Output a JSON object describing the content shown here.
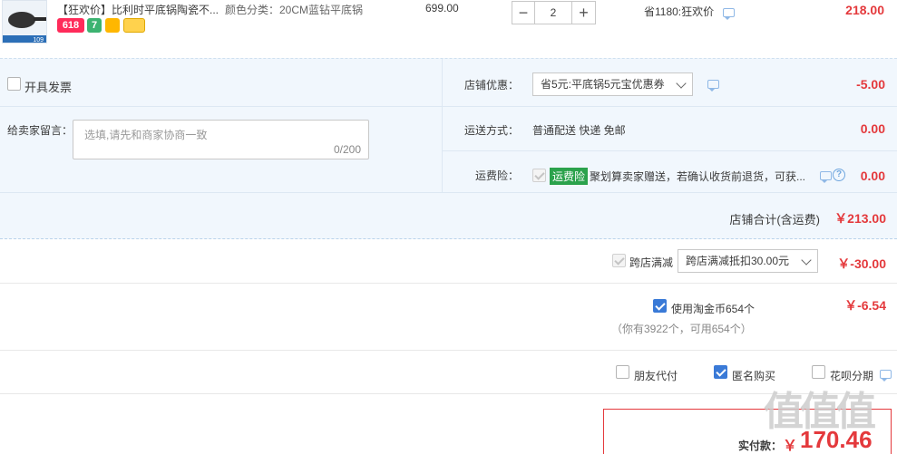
{
  "item": {
    "title": "【狂欢价】比利时平底锅陶瓷不...",
    "spec": "颜色分类：20CM蓝钻平底锅",
    "price": "699.00",
    "quantity": "2",
    "saving": "省1180:狂欢价",
    "subtotal": "218.00",
    "badge_618": "618",
    "badge_7": "7",
    "thumb_text": "109"
  },
  "invoice": {
    "label": "开具发票"
  },
  "message": {
    "label": "给卖家留言：",
    "placeholder": "选填,请先和商家协商一致",
    "counter": "0/200"
  },
  "shop_discount": {
    "label": "店铺优惠：",
    "value": "省5元:平底锅5元宝优惠券",
    "amount": "-5.00"
  },
  "shipping": {
    "label": "运送方式：",
    "value": "普通配送 快递 免邮",
    "amount": "0.00"
  },
  "insurance": {
    "label": "运费险：",
    "tag": "运费险",
    "text": "聚划算卖家赠送，若确认收货前退货，可获...",
    "amount": "0.00",
    "help": "?"
  },
  "shop_total": {
    "label": "店铺合计(含运费)",
    "amount": "￥213.00"
  },
  "cross_shop": {
    "label": "跨店满减",
    "value": "跨店满减抵扣30.00元",
    "amount": "￥-30.00"
  },
  "coins": {
    "label": "使用淘金币654个",
    "note": "（你有3922个，可用654个）",
    "amount": "￥-6.54"
  },
  "options": {
    "friend_pay": "朋友代付",
    "anonymous": "匿名购买",
    "huabei": "花呗分期"
  },
  "final": {
    "label": "实付款：",
    "currency": "￥",
    "amount": "170.46"
  },
  "watermark": "值"
}
